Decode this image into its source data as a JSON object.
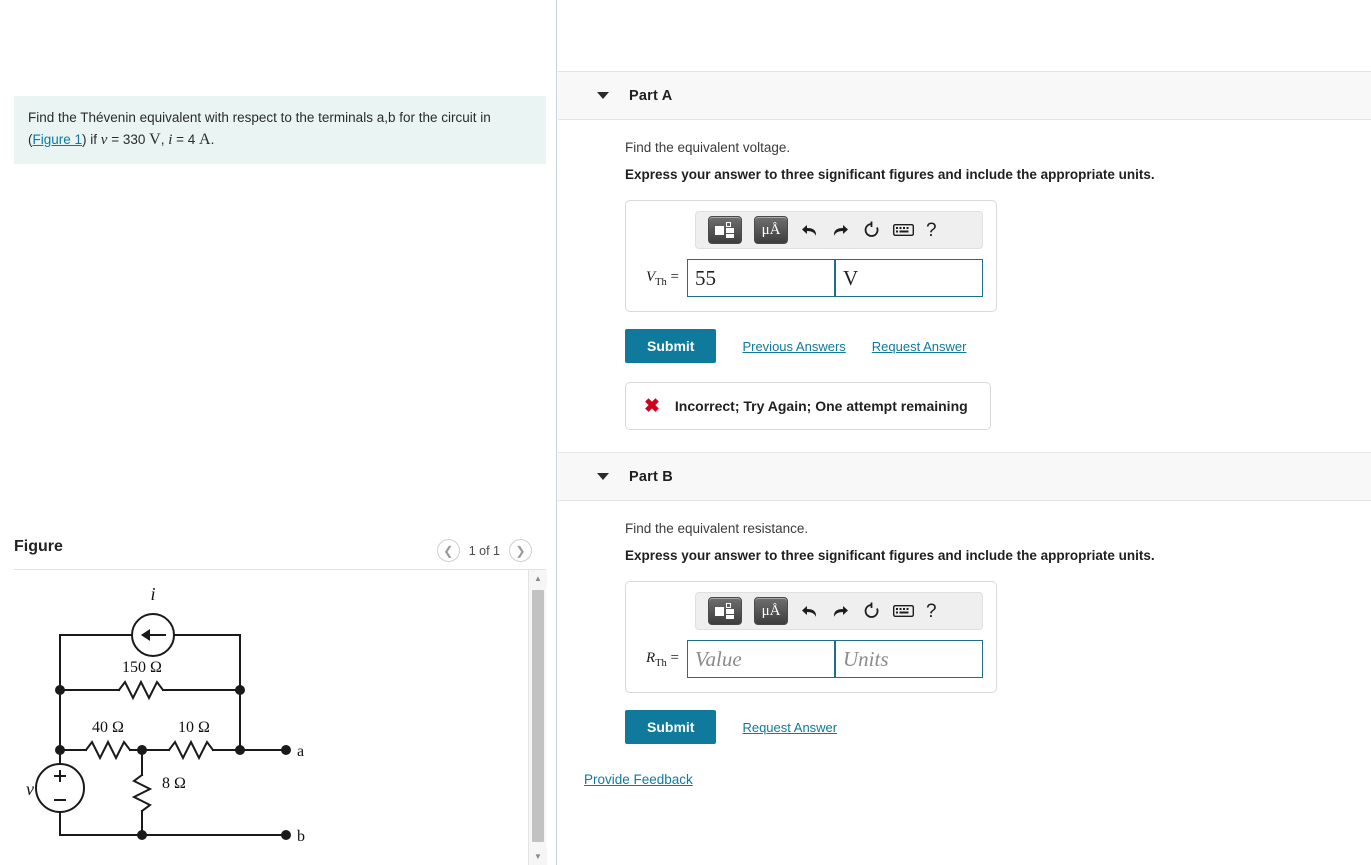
{
  "question": {
    "text_before_link": "Find the Thévenin equivalent with respect to the terminals a,b for the circuit in",
    "link_label": "Figure 1",
    "text_after_link": ") if ",
    "open_paren": "(",
    "v_symbol": "v",
    "v_eq": " = 330 ",
    "v_unit": "V",
    "comma": ", ",
    "i_symbol": "i",
    "i_eq": " = 4 ",
    "i_unit": "A",
    "period": "."
  },
  "figure": {
    "title": "Figure",
    "prev_icon": "chevron-left-icon",
    "next_icon": "chevron-right-icon",
    "count_label": "1 of 1",
    "circuit": {
      "current_source_label": "i",
      "voltage_source_label": "v",
      "voltage_plus": "+",
      "voltage_minus": "−",
      "r_150": "150 Ω",
      "r_40": "40 Ω",
      "r_10": "10 Ω",
      "r_8": "8 Ω",
      "terminal_a": "a",
      "terminal_b": "b"
    }
  },
  "toolbar": {
    "template_icon": "math-template-icon",
    "units_label": "μÅ",
    "undo_icon": "undo-arrow-icon",
    "redo_icon": "redo-arrow-icon",
    "reset_icon": "reset-circle-icon",
    "keyboard_icon": "keyboard-icon",
    "help_icon": "question-mark-icon",
    "undo_glyph": "↩",
    "redo_glyph": "↪",
    "reset_glyph": "↻",
    "keyboard_glyph": "⌨",
    "help_glyph": "?"
  },
  "parts": [
    {
      "id": "part-a",
      "header": "Part A",
      "caret_icon": "caret-down-icon",
      "prompt": "Find the equivalent voltage.",
      "instruction": "Express your answer to three significant figures and include the appropriate units.",
      "answer_label_var": "V",
      "answer_label_sub": "Th",
      "answer_label_eq": " =",
      "value": "55",
      "value_placeholder": "Value",
      "units": "V",
      "units_placeholder": "Units",
      "submit_label": "Submit",
      "previous_answers_label": "Previous Answers",
      "request_answer_label": "Request Answer",
      "feedback_icon": "x-mark-icon",
      "feedback_glyph": "✖",
      "feedback_text": "Incorrect; Try Again; One attempt remaining"
    },
    {
      "id": "part-b",
      "header": "Part B",
      "caret_icon": "caret-down-icon",
      "prompt": "Find the equivalent resistance.",
      "instruction": "Express your answer to three significant figures and include the appropriate units.",
      "answer_label_var": "R",
      "answer_label_sub": "Th",
      "answer_label_eq": " =",
      "value": "",
      "value_placeholder": "Value",
      "units": "",
      "units_placeholder": "Units",
      "submit_label": "Submit",
      "request_answer_label": "Request Answer"
    }
  ],
  "footer": {
    "provide_feedback_label": "Provide Feedback"
  },
  "colors": {
    "accent": "#0f7a9c",
    "question_bg": "#e9f4f3",
    "error": "#d0021b",
    "input_border": "#1d6f8b"
  }
}
